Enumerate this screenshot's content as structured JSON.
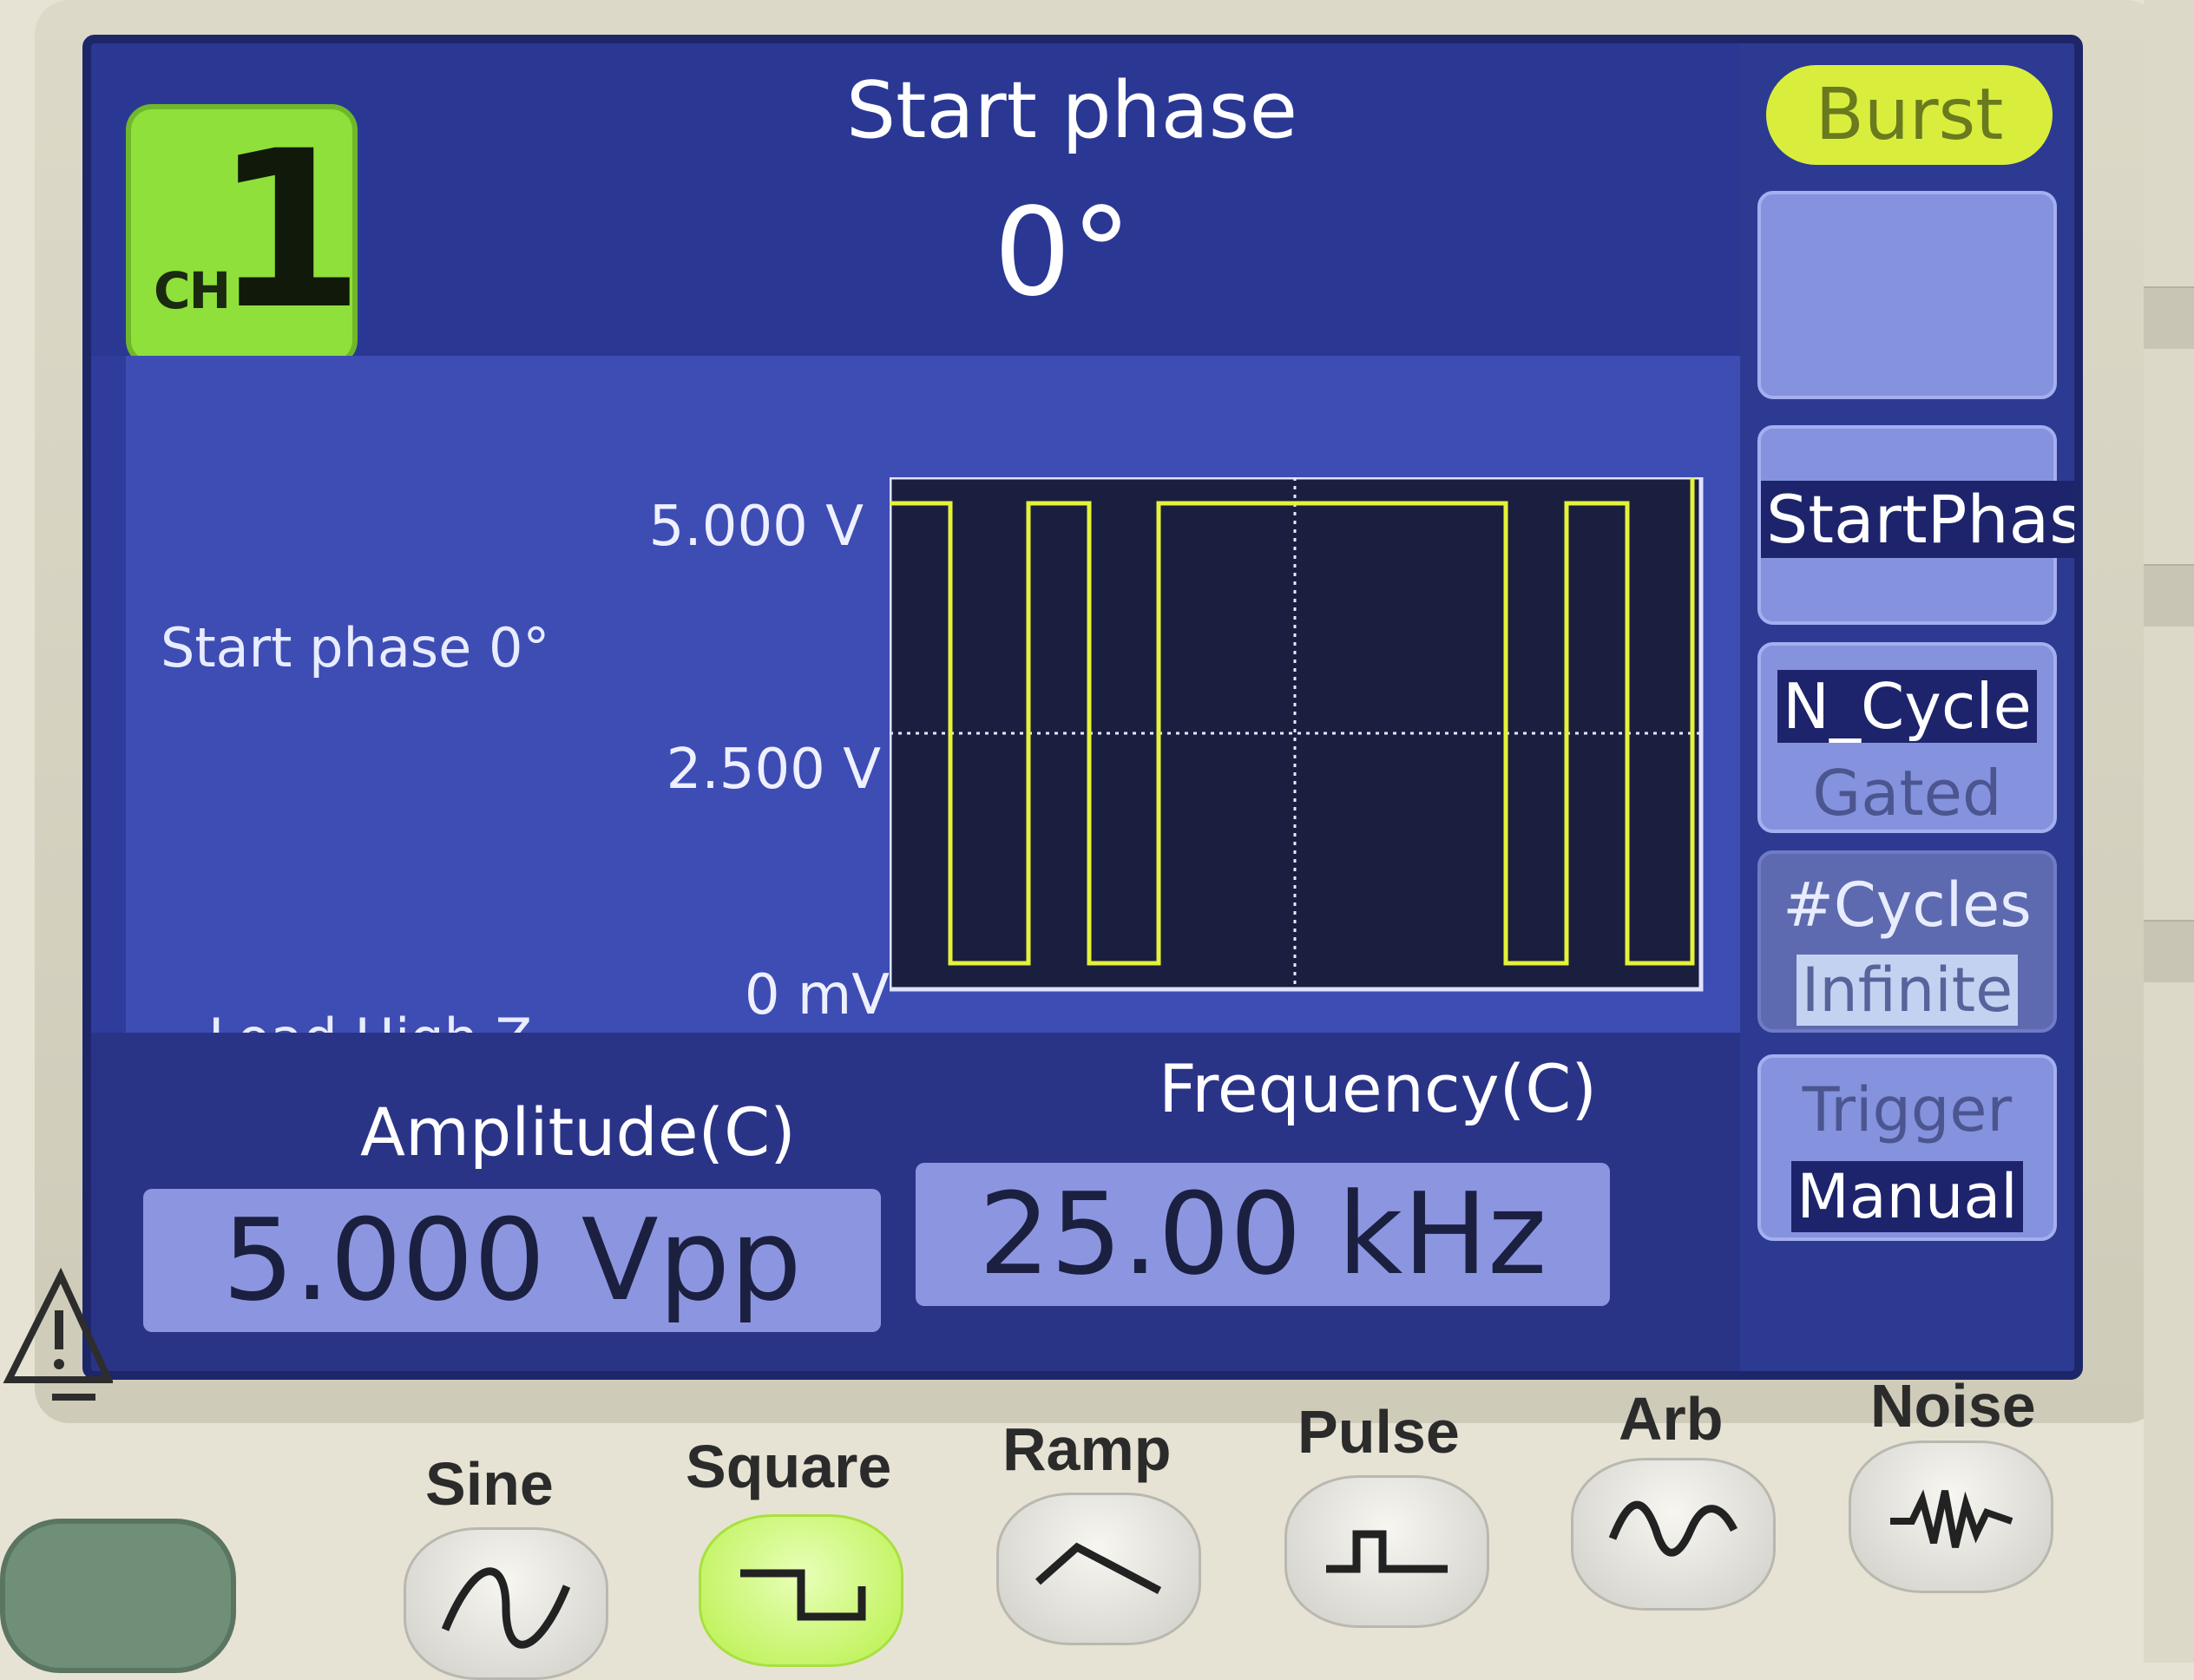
{
  "channel": {
    "prefix": "CH",
    "number": "1"
  },
  "header": {
    "title": "Start phase",
    "value": "0°"
  },
  "plot": {
    "info_phase": "Start phase 0°",
    "info_load": "Load High Z",
    "y_top": "5.000 V",
    "y_mid": "2.500 V",
    "y_bottom": "0 mV",
    "trace_color": "#e4f23a"
  },
  "params": {
    "amplitude_label": "Amplitude(C)",
    "amplitude_value": "5.000 Vpp",
    "frequency_label": "Frequency(C)",
    "frequency_value": "25.00 kHz"
  },
  "softkeys": {
    "mode": "Burst",
    "start_phase": "StartPhase",
    "ncycle": "N_Cycle",
    "gated": "Gated",
    "cycles": "#Cycles",
    "infinite": "Infinite",
    "trigger": "Trigger",
    "manual": "Manual"
  },
  "waveform_keys": [
    "Sine",
    "Square",
    "Ramp",
    "Pulse",
    "Arb",
    "Noise"
  ],
  "active_waveform": "Square",
  "icons": [
    "sine-wave-icon",
    "square-wave-icon",
    "ramp-wave-icon",
    "pulse-wave-icon",
    "arb-wave-icon",
    "noise-wave-icon",
    "warning-icon"
  ]
}
